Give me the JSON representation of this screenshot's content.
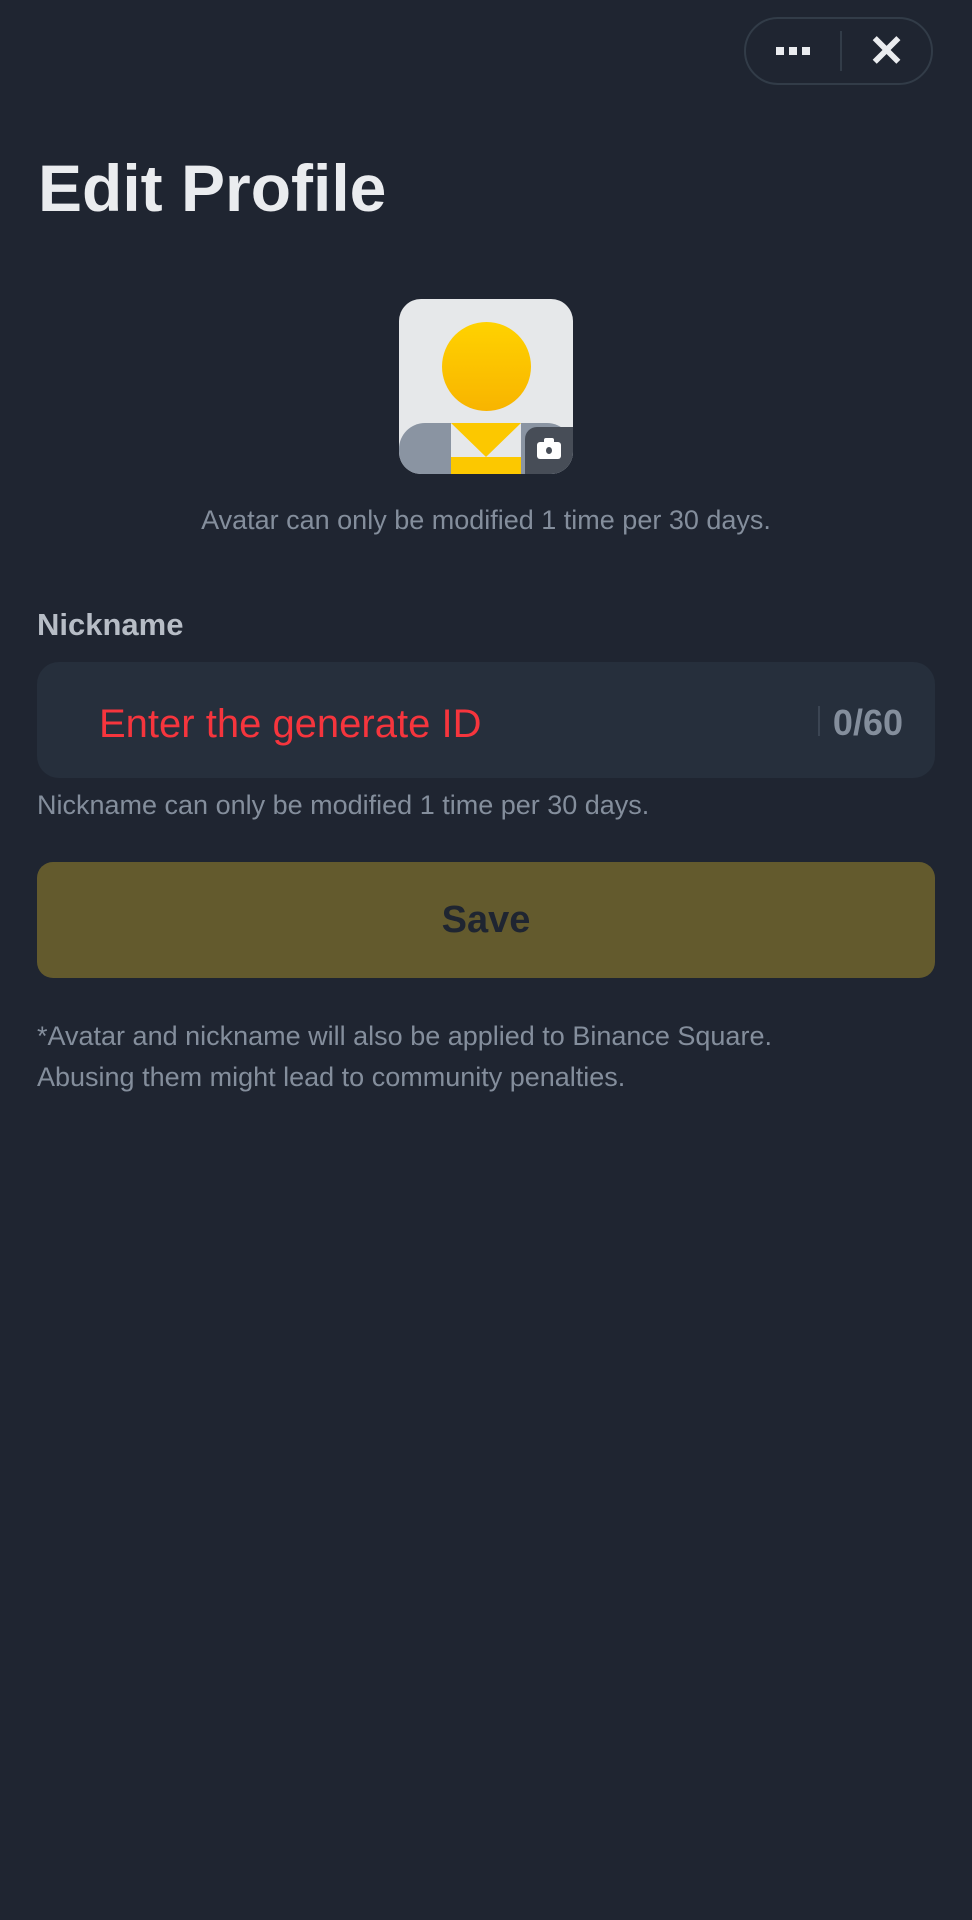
{
  "header": {
    "more_icon": "more-horizontal-icon",
    "close_icon": "close-icon",
    "close_glyph": "✕"
  },
  "page_title": "Edit Profile",
  "avatar": {
    "caption": "Avatar can only be modified 1 time per 30 days.",
    "camera_icon": "camera-icon"
  },
  "nickname": {
    "label": "Nickname",
    "placeholder": "Enter the generate ID",
    "counter": "0/60",
    "hint": "Nickname can only be modified 1 time per 30 days."
  },
  "save_label": "Save",
  "footer": {
    "line1": "*Avatar and nickname will also be applied to Binance Square.",
    "line2": "Abusing them might lead to community penalties."
  },
  "colors": {
    "background": "#1f2531",
    "input": "#262f3c",
    "save_button": "#635a2d",
    "placeholder": "#f6353d",
    "muted_text": "#848e9c"
  }
}
